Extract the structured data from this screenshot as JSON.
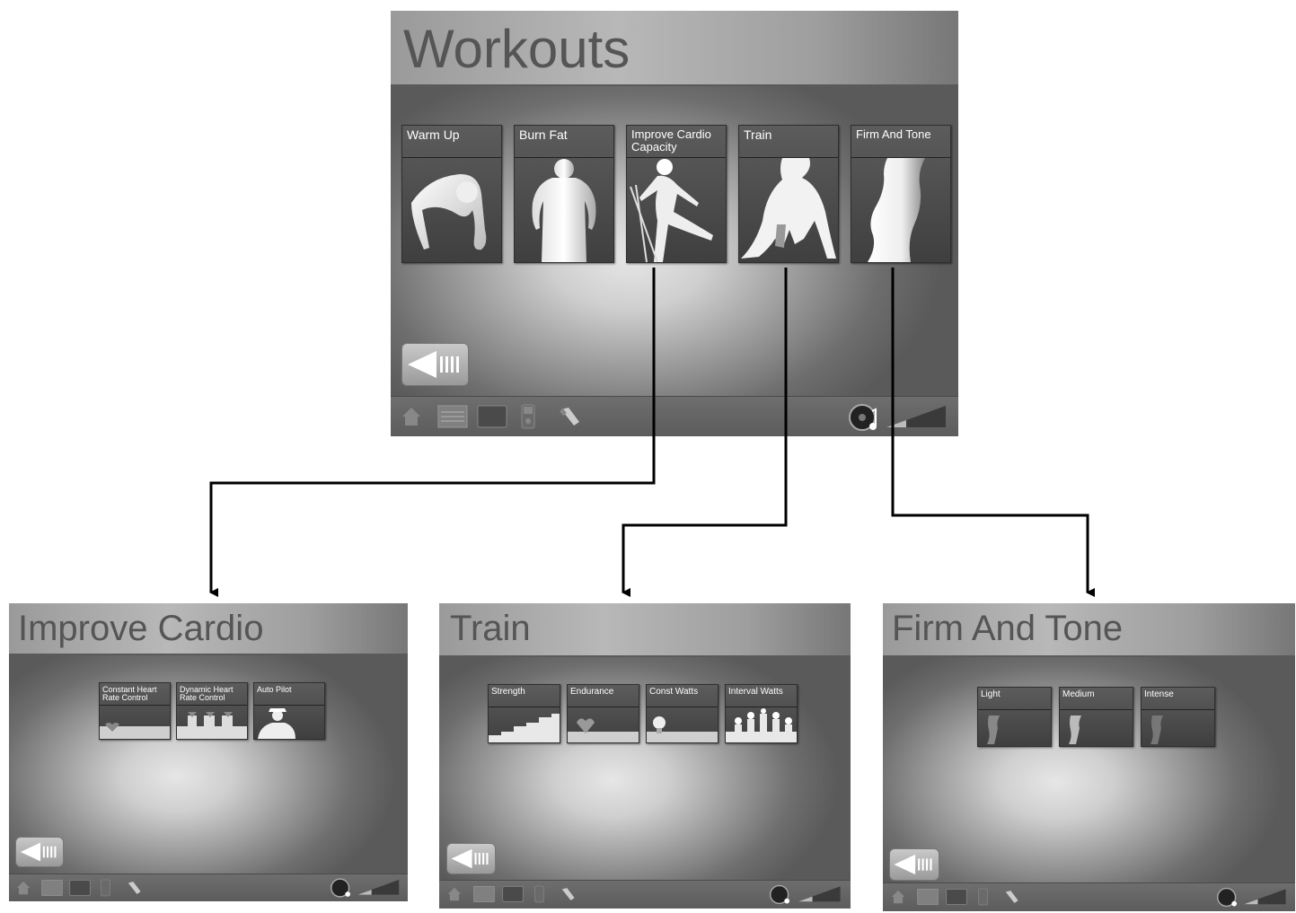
{
  "workouts": {
    "title": "Workouts",
    "tiles": [
      {
        "label": "Warm Up",
        "icon": "warm-up-figure-icon"
      },
      {
        "label": "Burn Fat",
        "icon": "burn-fat-figure-icon"
      },
      {
        "label": "Improve Cardio Capacity",
        "icon": "cardio-skier-figure-icon"
      },
      {
        "label": "Train",
        "icon": "sprinter-figure-icon"
      },
      {
        "label": "Firm And Tone",
        "icon": "toned-body-figure-icon"
      }
    ]
  },
  "improve_cardio": {
    "title": "Improve Cardio",
    "tiles": [
      {
        "label": "Constant Heart Rate Control",
        "icon": "constant-heart-rate-icon"
      },
      {
        "label": "Dynamic Heart Rate Control",
        "icon": "dynamic-heart-rate-icon"
      },
      {
        "label": "Auto Pilot",
        "icon": "pilot-icon"
      }
    ]
  },
  "train": {
    "title": "Train",
    "tiles": [
      {
        "label": "Strength",
        "icon": "strength-stairs-icon"
      },
      {
        "label": "Endurance",
        "icon": "endurance-heart-icon"
      },
      {
        "label": "Const Watts",
        "icon": "const-watts-bulb-icon"
      },
      {
        "label": "Interval Watts",
        "icon": "interval-watts-bulbs-icon"
      }
    ]
  },
  "firm_and_tone": {
    "title": "Firm And Tone",
    "tiles": [
      {
        "label": "Light",
        "icon": "light-intensity-icon"
      },
      {
        "label": "Medium",
        "icon": "medium-intensity-icon"
      },
      {
        "label": "Intense",
        "icon": "intense-intensity-icon"
      }
    ]
  },
  "bottom_bar_icons": [
    "home-icon",
    "keyboard-icon",
    "screen-icon",
    "ipod-icon",
    "usb-key-icon",
    "music-note-icon",
    "volume-icon"
  ],
  "back_button_icon": "back-arrow-icon"
}
